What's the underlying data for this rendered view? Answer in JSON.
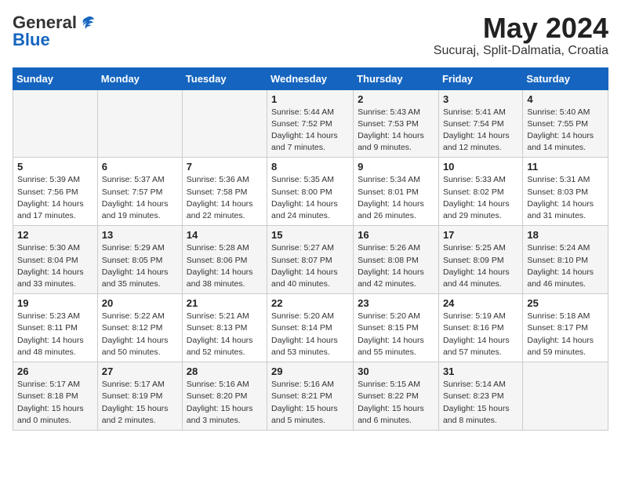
{
  "header": {
    "logo_general": "General",
    "logo_blue": "Blue",
    "month": "May 2024",
    "location": "Sucuraj, Split-Dalmatia, Croatia"
  },
  "days_of_week": [
    "Sunday",
    "Monday",
    "Tuesday",
    "Wednesday",
    "Thursday",
    "Friday",
    "Saturday"
  ],
  "weeks": [
    [
      {
        "day": "",
        "info": ""
      },
      {
        "day": "",
        "info": ""
      },
      {
        "day": "",
        "info": ""
      },
      {
        "day": "1",
        "info": "Sunrise: 5:44 AM\nSunset: 7:52 PM\nDaylight: 14 hours\nand 7 minutes."
      },
      {
        "day": "2",
        "info": "Sunrise: 5:43 AM\nSunset: 7:53 PM\nDaylight: 14 hours\nand 9 minutes."
      },
      {
        "day": "3",
        "info": "Sunrise: 5:41 AM\nSunset: 7:54 PM\nDaylight: 14 hours\nand 12 minutes."
      },
      {
        "day": "4",
        "info": "Sunrise: 5:40 AM\nSunset: 7:55 PM\nDaylight: 14 hours\nand 14 minutes."
      }
    ],
    [
      {
        "day": "5",
        "info": "Sunrise: 5:39 AM\nSunset: 7:56 PM\nDaylight: 14 hours\nand 17 minutes."
      },
      {
        "day": "6",
        "info": "Sunrise: 5:37 AM\nSunset: 7:57 PM\nDaylight: 14 hours\nand 19 minutes."
      },
      {
        "day": "7",
        "info": "Sunrise: 5:36 AM\nSunset: 7:58 PM\nDaylight: 14 hours\nand 22 minutes."
      },
      {
        "day": "8",
        "info": "Sunrise: 5:35 AM\nSunset: 8:00 PM\nDaylight: 14 hours\nand 24 minutes."
      },
      {
        "day": "9",
        "info": "Sunrise: 5:34 AM\nSunset: 8:01 PM\nDaylight: 14 hours\nand 26 minutes."
      },
      {
        "day": "10",
        "info": "Sunrise: 5:33 AM\nSunset: 8:02 PM\nDaylight: 14 hours\nand 29 minutes."
      },
      {
        "day": "11",
        "info": "Sunrise: 5:31 AM\nSunset: 8:03 PM\nDaylight: 14 hours\nand 31 minutes."
      }
    ],
    [
      {
        "day": "12",
        "info": "Sunrise: 5:30 AM\nSunset: 8:04 PM\nDaylight: 14 hours\nand 33 minutes."
      },
      {
        "day": "13",
        "info": "Sunrise: 5:29 AM\nSunset: 8:05 PM\nDaylight: 14 hours\nand 35 minutes."
      },
      {
        "day": "14",
        "info": "Sunrise: 5:28 AM\nSunset: 8:06 PM\nDaylight: 14 hours\nand 38 minutes."
      },
      {
        "day": "15",
        "info": "Sunrise: 5:27 AM\nSunset: 8:07 PM\nDaylight: 14 hours\nand 40 minutes."
      },
      {
        "day": "16",
        "info": "Sunrise: 5:26 AM\nSunset: 8:08 PM\nDaylight: 14 hours\nand 42 minutes."
      },
      {
        "day": "17",
        "info": "Sunrise: 5:25 AM\nSunset: 8:09 PM\nDaylight: 14 hours\nand 44 minutes."
      },
      {
        "day": "18",
        "info": "Sunrise: 5:24 AM\nSunset: 8:10 PM\nDaylight: 14 hours\nand 46 minutes."
      }
    ],
    [
      {
        "day": "19",
        "info": "Sunrise: 5:23 AM\nSunset: 8:11 PM\nDaylight: 14 hours\nand 48 minutes."
      },
      {
        "day": "20",
        "info": "Sunrise: 5:22 AM\nSunset: 8:12 PM\nDaylight: 14 hours\nand 50 minutes."
      },
      {
        "day": "21",
        "info": "Sunrise: 5:21 AM\nSunset: 8:13 PM\nDaylight: 14 hours\nand 52 minutes."
      },
      {
        "day": "22",
        "info": "Sunrise: 5:20 AM\nSunset: 8:14 PM\nDaylight: 14 hours\nand 53 minutes."
      },
      {
        "day": "23",
        "info": "Sunrise: 5:20 AM\nSunset: 8:15 PM\nDaylight: 14 hours\nand 55 minutes."
      },
      {
        "day": "24",
        "info": "Sunrise: 5:19 AM\nSunset: 8:16 PM\nDaylight: 14 hours\nand 57 minutes."
      },
      {
        "day": "25",
        "info": "Sunrise: 5:18 AM\nSunset: 8:17 PM\nDaylight: 14 hours\nand 59 minutes."
      }
    ],
    [
      {
        "day": "26",
        "info": "Sunrise: 5:17 AM\nSunset: 8:18 PM\nDaylight: 15 hours\nand 0 minutes."
      },
      {
        "day": "27",
        "info": "Sunrise: 5:17 AM\nSunset: 8:19 PM\nDaylight: 15 hours\nand 2 minutes."
      },
      {
        "day": "28",
        "info": "Sunrise: 5:16 AM\nSunset: 8:20 PM\nDaylight: 15 hours\nand 3 minutes."
      },
      {
        "day": "29",
        "info": "Sunrise: 5:16 AM\nSunset: 8:21 PM\nDaylight: 15 hours\nand 5 minutes."
      },
      {
        "day": "30",
        "info": "Sunrise: 5:15 AM\nSunset: 8:22 PM\nDaylight: 15 hours\nand 6 minutes."
      },
      {
        "day": "31",
        "info": "Sunrise: 5:14 AM\nSunset: 8:23 PM\nDaylight: 15 hours\nand 8 minutes."
      },
      {
        "day": "",
        "info": ""
      }
    ]
  ]
}
